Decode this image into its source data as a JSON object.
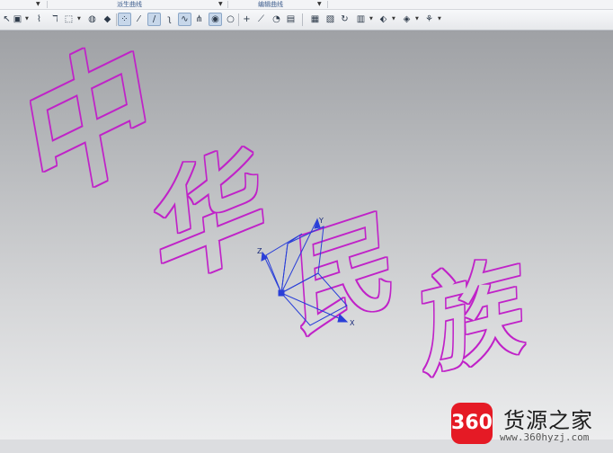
{
  "menu": {
    "group_derived_curve": "派生曲线",
    "group_edit_curve": "编辑曲线"
  },
  "toolbar": {
    "icons": [
      "arrow-icon",
      "select-icon",
      "tool-a-icon",
      "tool-b-icon",
      "rectangle-select-icon",
      "shaded-sphere-icon",
      "cube-icon",
      "point-set-icon",
      "line-icon",
      "line-diagonal-icon",
      "arc-icon",
      "spline-icon",
      "fan-icon",
      "circle-target-icon",
      "circle-icon",
      "cross-icon",
      "slash-icon",
      "shape-icon",
      "book-icon",
      "window-a-icon",
      "window-b-icon",
      "rotate-icon",
      "table-icon",
      "arrange-icon",
      "cube-view-icon",
      "paint-icon"
    ]
  },
  "viewport": {
    "text_curves": [
      "中",
      "华",
      "民",
      "族"
    ],
    "axis_labels": {
      "x": "X",
      "y": "Y",
      "z": "Z"
    },
    "colors": {
      "curve": "#c020c8",
      "axis": "#2a3fd8"
    }
  },
  "watermark": {
    "logo_text": "360",
    "site_name": "货源之家",
    "url": "www.360hyzj.com"
  }
}
